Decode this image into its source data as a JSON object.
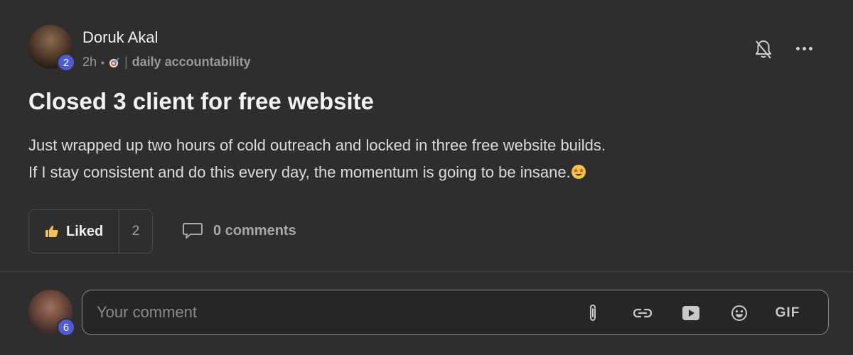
{
  "post": {
    "author": {
      "name": "Doruk Akal",
      "level": "2",
      "time": "2h",
      "category": "daily accountability"
    },
    "title": "Closed 3 client for free website",
    "body": [
      "Just wrapped up two hours of cold outreach and locked in three free website builds.",
      "If I stay consistent and do this every day, the momentum is going to be insane."
    ],
    "likes": {
      "label": "Liked",
      "count": "2"
    },
    "comments": {
      "label": "0 comments"
    }
  },
  "composer": {
    "user_level": "6",
    "placeholder": "Your comment",
    "gif_label": "GIF"
  },
  "icons": {
    "notification": "bell-off-icon",
    "more": "more-horizontal-icon",
    "like": "thumbs-up-icon",
    "comment": "speech-bubble-icon",
    "category": "target-icon",
    "emoji": "star-struck-emoji",
    "attach": "paperclip-icon",
    "link": "link-icon",
    "video": "video-play-icon",
    "emoji_picker": "smiley-icon"
  },
  "colors": {
    "background": "#2e2e2e",
    "level_badge": "#4f5bd5",
    "like_thumb": "#f2c14e"
  }
}
